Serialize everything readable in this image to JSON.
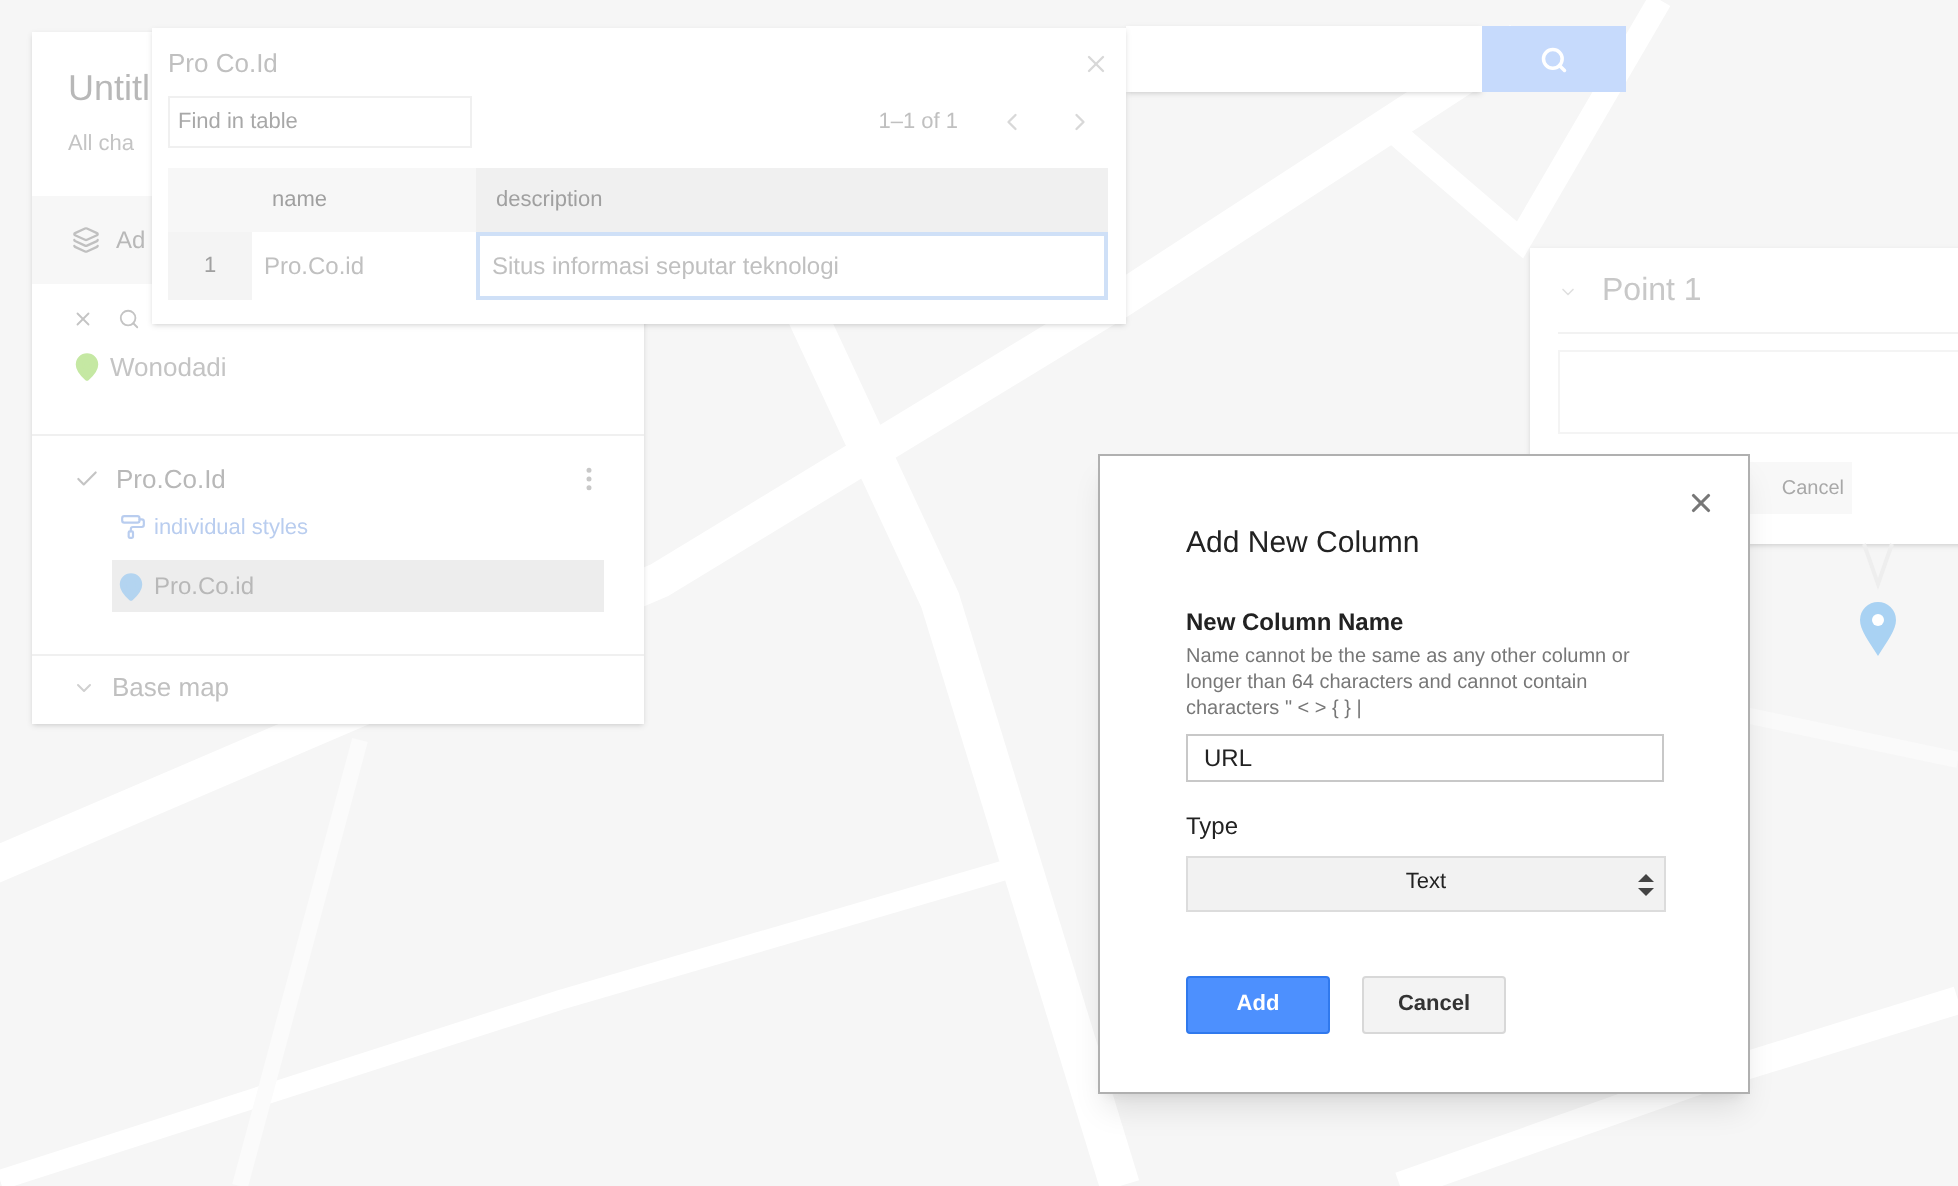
{
  "sidebar": {
    "title": "Untitl",
    "subtitle": "All cha",
    "add_layer": "Ad",
    "search_layer": {
      "items": [
        {
          "label": "Wonodadi"
        }
      ]
    },
    "layer": {
      "name": "Pro.Co.Id",
      "checked": true,
      "style": "individual styles",
      "items": [
        {
          "label": "Pro.Co.id",
          "selected": true
        }
      ]
    },
    "base_map": "Base map"
  },
  "table": {
    "title": "Pro Co.Id",
    "search": {
      "placeholder": "Find in table"
    },
    "pager": "1–1 of 1",
    "columns": [
      "name",
      "description"
    ],
    "rows": [
      {
        "number": "1",
        "cells": [
          {
            "text": "Pro.Co.id",
            "selected": false
          },
          {
            "text": "Situs informasi seputar teknologi",
            "selected": true
          }
        ]
      }
    ]
  },
  "point_popup": {
    "title": "Point 1",
    "cancel": "Cancel"
  },
  "dialog": {
    "title": "Add New Column",
    "field_label": "New Column Name",
    "help": "Name cannot be the same as any other column or longer than 64 characters and cannot contain characters \" < > { } |",
    "value": "URL",
    "type_label": "Type",
    "type_value": "Text",
    "buttons": [
      {
        "label": "Add",
        "kind": "primary"
      },
      {
        "label": "Cancel",
        "kind": "secondary"
      }
    ]
  }
}
